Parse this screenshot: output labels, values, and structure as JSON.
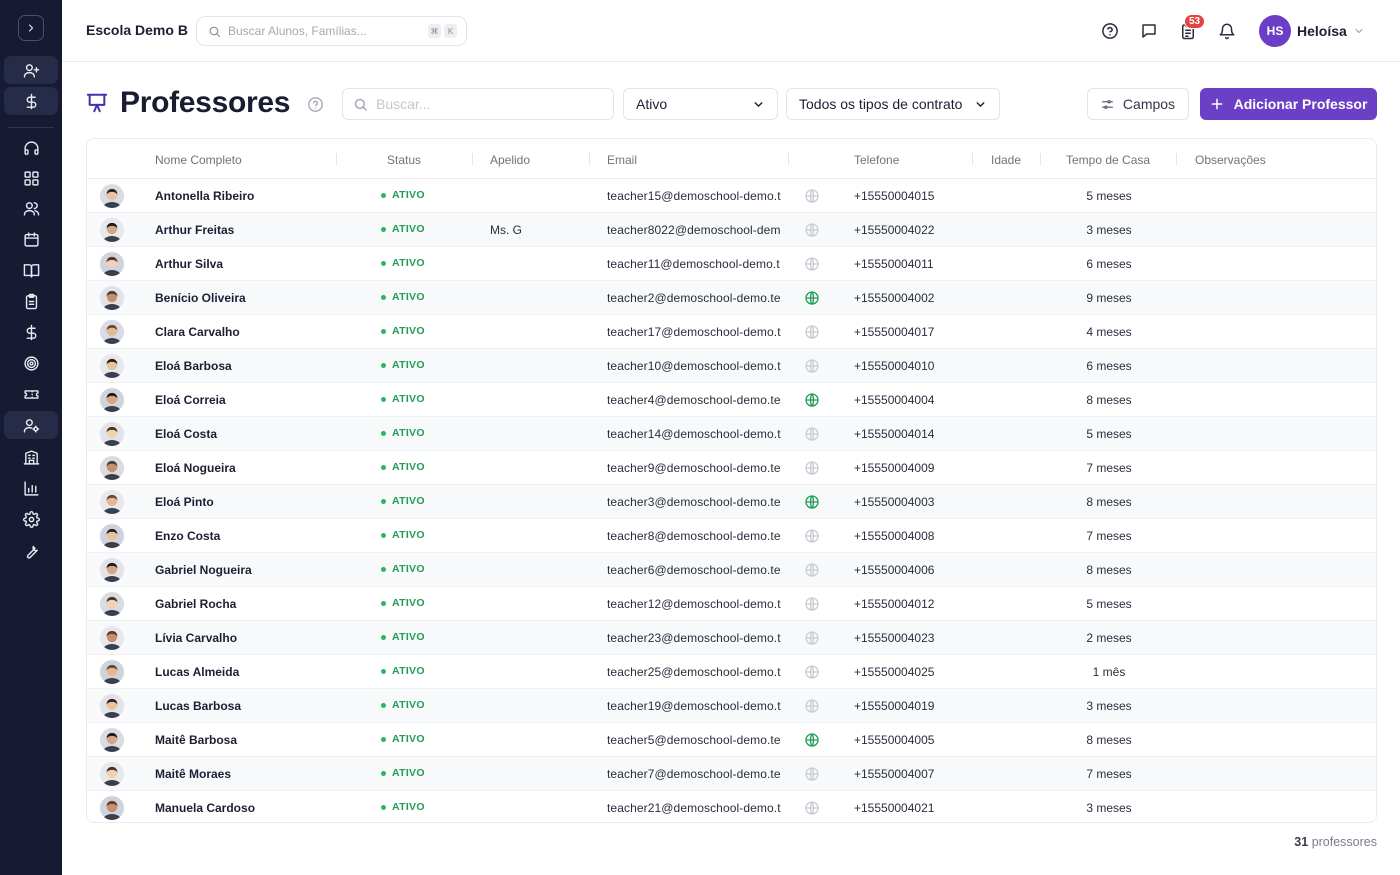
{
  "app": {
    "school_name": "Escola Demo B"
  },
  "global_search": {
    "placeholder": "Buscar Alunos, Famílias...",
    "shortcut_keys": [
      "⌘",
      "K"
    ]
  },
  "header": {
    "notification_badge": "53",
    "user_initials": "HS",
    "user_name": "Heloísa"
  },
  "colors": {
    "accent": "#6c40c6",
    "rail": "#161a33",
    "status_green": "#1f9d55"
  },
  "rail": {
    "icons": [
      "chevron-right-icon",
      "user-plus-icon",
      "dollar-icon",
      "headset-icon",
      "dashboard-icon",
      "users-icon",
      "calendar-icon",
      "book-icon",
      "clipboard-icon",
      "dollar-icon",
      "target-icon",
      "ticket-icon",
      "user-settings-icon",
      "building-icon",
      "chart-icon",
      "gear-icon",
      "wrench-icon"
    ]
  },
  "page": {
    "title": "Professores",
    "search_placeholder": "Buscar...",
    "status_filter": "Ativo",
    "contract_filter": "Todos os tipos de contrato",
    "fields_button": "Campos",
    "add_button": "Adicionar Professor"
  },
  "table": {
    "columns": [
      "Nome Completo",
      "Status",
      "Apelido",
      "Email",
      "Telefone",
      "Idade",
      "Tempo de Casa",
      "Observações"
    ],
    "rows": [
      {
        "name": "Antonella Ribeiro",
        "status": "ATIVO",
        "nickname": "",
        "email": "teacher15@demoschool-demo.t",
        "globe_active": false,
        "phone": "+15550004015",
        "tenure": "5 meses"
      },
      {
        "name": "Arthur Freitas",
        "status": "ATIVO",
        "nickname": "Ms. G",
        "email": "teacher8022@demoschool-dem",
        "globe_active": false,
        "phone": "+15550004022",
        "tenure": "3 meses"
      },
      {
        "name": "Arthur Silva",
        "status": "ATIVO",
        "nickname": "",
        "email": "teacher11@demoschool-demo.t",
        "globe_active": false,
        "phone": "+15550004011",
        "tenure": "6 meses"
      },
      {
        "name": "Benício Oliveira",
        "status": "ATIVO",
        "nickname": "",
        "email": "teacher2@demoschool-demo.te",
        "globe_active": true,
        "phone": "+15550004002",
        "tenure": "9 meses"
      },
      {
        "name": "Clara Carvalho",
        "status": "ATIVO",
        "nickname": "",
        "email": "teacher17@demoschool-demo.t",
        "globe_active": false,
        "phone": "+15550004017",
        "tenure": "4 meses"
      },
      {
        "name": "Eloá Barbosa",
        "status": "ATIVO",
        "nickname": "",
        "email": "teacher10@demoschool-demo.t",
        "globe_active": false,
        "phone": "+15550004010",
        "tenure": "6 meses"
      },
      {
        "name": "Eloá Correia",
        "status": "ATIVO",
        "nickname": "",
        "email": "teacher4@demoschool-demo.te",
        "globe_active": true,
        "phone": "+15550004004",
        "tenure": "8 meses"
      },
      {
        "name": "Eloá Costa",
        "status": "ATIVO",
        "nickname": "",
        "email": "teacher14@demoschool-demo.t",
        "globe_active": false,
        "phone": "+15550004014",
        "tenure": "5 meses"
      },
      {
        "name": "Eloá Nogueira",
        "status": "ATIVO",
        "nickname": "",
        "email": "teacher9@demoschool-demo.te",
        "globe_active": false,
        "phone": "+15550004009",
        "tenure": "7 meses"
      },
      {
        "name": "Eloá Pinto",
        "status": "ATIVO",
        "nickname": "",
        "email": "teacher3@demoschool-demo.te",
        "globe_active": true,
        "phone": "+15550004003",
        "tenure": "8 meses"
      },
      {
        "name": "Enzo Costa",
        "status": "ATIVO",
        "nickname": "",
        "email": "teacher8@demoschool-demo.te",
        "globe_active": false,
        "phone": "+15550004008",
        "tenure": "7 meses"
      },
      {
        "name": "Gabriel Nogueira",
        "status": "ATIVO",
        "nickname": "",
        "email": "teacher6@demoschool-demo.te",
        "globe_active": false,
        "phone": "+15550004006",
        "tenure": "8 meses"
      },
      {
        "name": "Gabriel Rocha",
        "status": "ATIVO",
        "nickname": "",
        "email": "teacher12@demoschool-demo.t",
        "globe_active": false,
        "phone": "+15550004012",
        "tenure": "5 meses"
      },
      {
        "name": "Lívia Carvalho",
        "status": "ATIVO",
        "nickname": "",
        "email": "teacher23@demoschool-demo.t",
        "globe_active": false,
        "phone": "+15550004023",
        "tenure": "2 meses"
      },
      {
        "name": "Lucas Almeida",
        "status": "ATIVO",
        "nickname": "",
        "email": "teacher25@demoschool-demo.t",
        "globe_active": false,
        "phone": "+15550004025",
        "tenure": "1 mês"
      },
      {
        "name": "Lucas Barbosa",
        "status": "ATIVO",
        "nickname": "",
        "email": "teacher19@demoschool-demo.t",
        "globe_active": false,
        "phone": "+15550004019",
        "tenure": "3 meses"
      },
      {
        "name": "Maitê Barbosa",
        "status": "ATIVO",
        "nickname": "",
        "email": "teacher5@demoschool-demo.te",
        "globe_active": true,
        "phone": "+15550004005",
        "tenure": "8 meses"
      },
      {
        "name": "Maitê Moraes",
        "status": "ATIVO",
        "nickname": "",
        "email": "teacher7@demoschool-demo.te",
        "globe_active": false,
        "phone": "+15550004007",
        "tenure": "7 meses"
      },
      {
        "name": "Manuela Cardoso",
        "status": "ATIVO",
        "nickname": "",
        "email": "teacher21@demoschool-demo.t",
        "globe_active": false,
        "phone": "+15550004021",
        "tenure": "3 meses"
      }
    ]
  },
  "footer": {
    "count": "31",
    "count_label": "professores"
  }
}
